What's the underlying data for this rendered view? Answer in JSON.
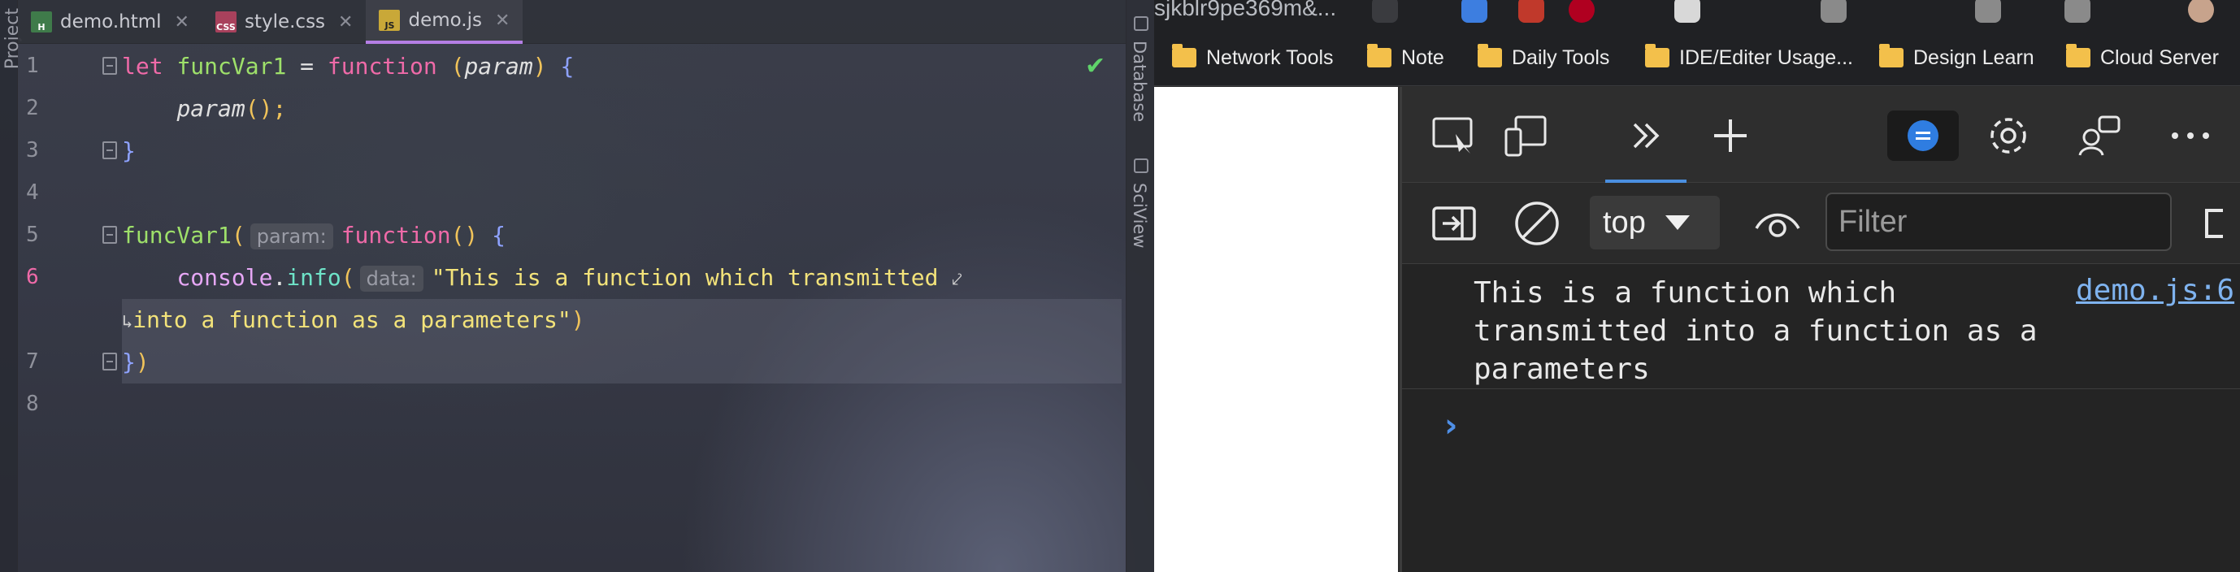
{
  "ide": {
    "left_tool_window": "Project",
    "tabs": [
      {
        "label": "demo.html",
        "icon_text": "H"
      },
      {
        "label": "style.css",
        "icon_text": "CSS"
      },
      {
        "label": "demo.js",
        "icon_text": "JS"
      }
    ],
    "line_numbers": [
      "1",
      "2",
      "3",
      "4",
      "5",
      "6",
      "",
      "7",
      "8"
    ],
    "code": {
      "l1_let": "let",
      "l1_name": "funcVar1",
      "l1_eq": " = ",
      "l1_function": "function",
      "l1_open": " (",
      "l1_param": "param",
      "l1_close": ") ",
      "l1_brace": "{",
      "l2_call": "param",
      "l2_rest": "();",
      "l3_brace": "}",
      "l5_call": "funcVar1",
      "l5_paren": "(",
      "l5_hint": "param:",
      "l5_function": "function",
      "l5_parens": "() ",
      "l5_brace": "{",
      "l6_obj": "console",
      "l6_dot": ".",
      "l6_method": "info",
      "l6_paren": "(",
      "l6_hint": "data:",
      "l6_string_a": "\"This is a function which transmitted",
      "l6_string_b": "into a function as a parameters\"",
      "l6_close": ")",
      "l7_brace": "}",
      "l7_paren": ")"
    },
    "right_tool_windows": [
      "Database",
      "SciView"
    ]
  },
  "browser": {
    "url_fragment": "sjkblr9pe369m&...",
    "bookmarks": [
      "Network Tools",
      "Note",
      "Daily Tools",
      "IDE/Editer Usage...",
      "Design Learn",
      "Cloud Server"
    ],
    "devtools": {
      "context": "top",
      "filter_placeholder": "Filter",
      "console_message": "This is a function which transmitted into a function as a parameters",
      "message_source": "demo.js:6",
      "prompt_symbol": "›"
    }
  }
}
